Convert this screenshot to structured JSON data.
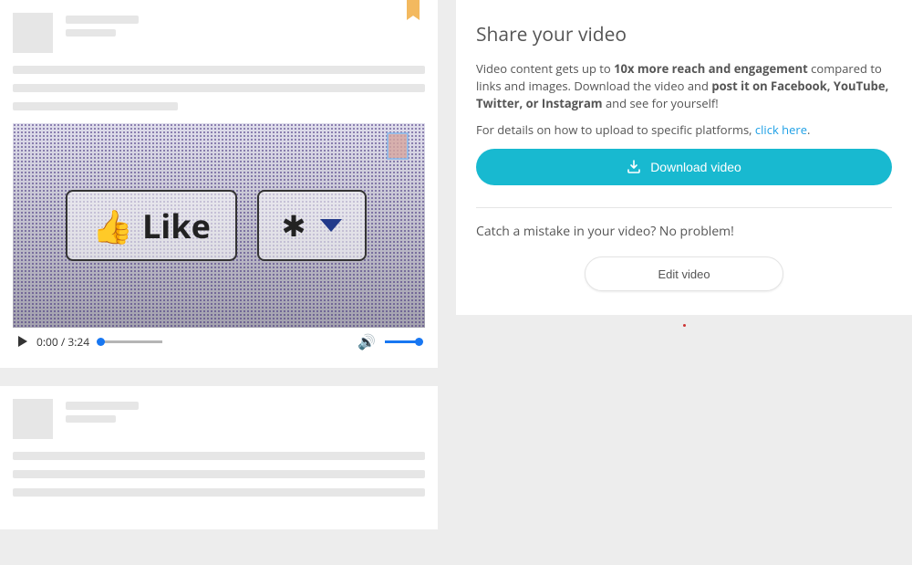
{
  "video": {
    "current_time": "0:00",
    "duration": "3:24",
    "like_label": "Like"
  },
  "share": {
    "title": "Share your video",
    "p1_pre": "Video content gets up to ",
    "p1_bold": "10x more reach and engagement",
    "p1_mid": " compared to links and images. Download the video and ",
    "p1_bold2": "post it on Facebook, YouTube, Twitter, or Instagram",
    "p1_post": " and see for yourself!",
    "p2_pre": "For details on how to upload to specific platforms, ",
    "p2_link": "click here",
    "p2_post": ".",
    "download_label": "Download video",
    "mistake_text": "Catch a mistake in your video? No problem!",
    "edit_label": "Edit video"
  }
}
